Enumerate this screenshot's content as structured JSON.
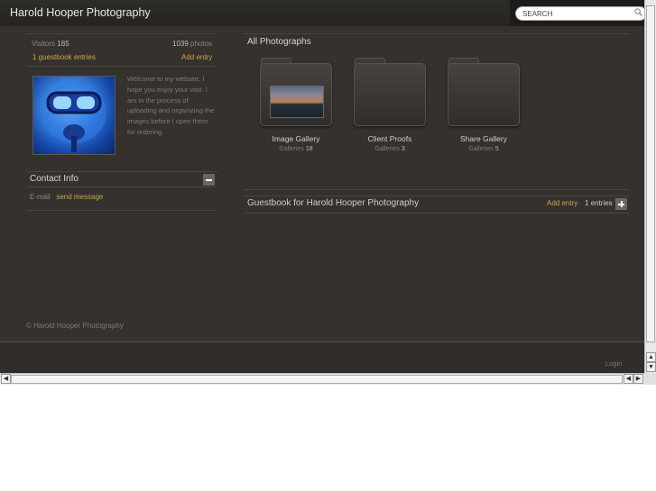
{
  "header": {
    "site_title": "Harold Hooper Photography",
    "search_placeholder": "SEARCH"
  },
  "sidebar": {
    "visitors_label": "Visitors",
    "visitors_count": "185",
    "photos_count": "1039",
    "photos_label": "photos",
    "guestbook_link": "1 guestbook entries",
    "add_entry": "Add entry",
    "welcome_text": "Welcome to my website, I hope you enjoy your visit. I am in the process of uploading and organizing the images before I open them for ordering.",
    "contact_title": "Contact Info",
    "email_label": "E-mail",
    "send_message": "send message"
  },
  "main": {
    "section_title": "All Photographs",
    "folders": [
      {
        "title": "Image Gallery",
        "count_label": "Galleries",
        "count": "18"
      },
      {
        "title": "Client Proofs",
        "count_label": "Galleries",
        "count": "3"
      },
      {
        "title": "Share Gallery",
        "count_label": "Galleries",
        "count": "5"
      }
    ],
    "guestbook": {
      "title": "Guestbook for Harold Hooper Photography",
      "add_entry": "Add entry",
      "entries": "1 entries"
    }
  },
  "footer": {
    "copyright": "© Harold Hooper Photography",
    "login": "Login"
  },
  "colors": {
    "background": "#35322e",
    "accent": "#c9a44a",
    "text_light": "#d8d5cf"
  }
}
